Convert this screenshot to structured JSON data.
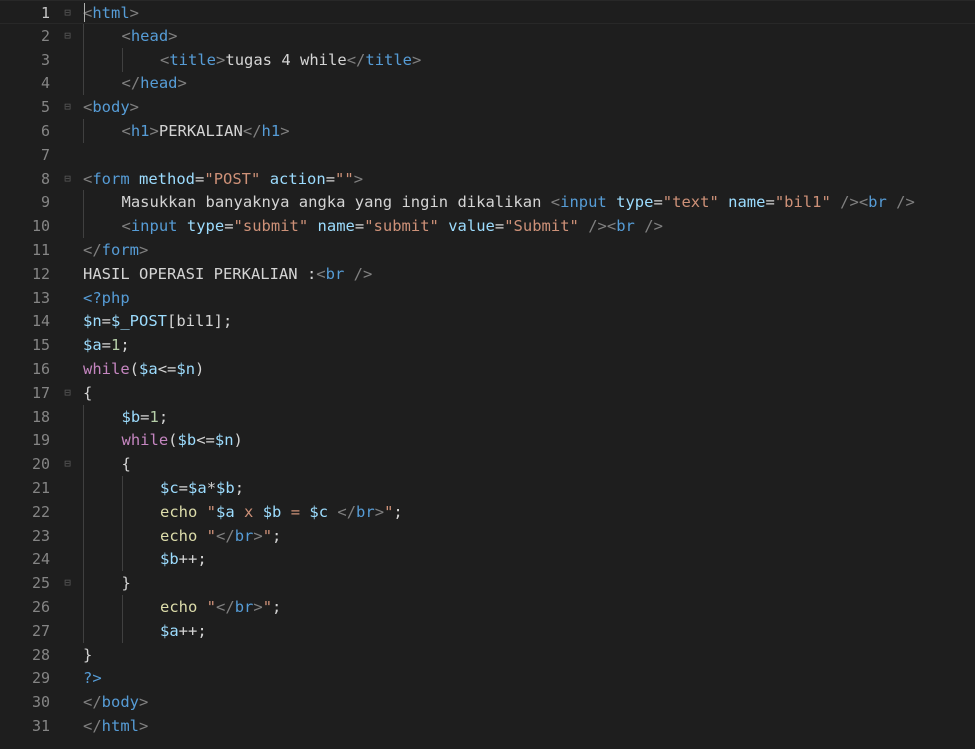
{
  "editor": {
    "language": "php",
    "active_line": 1,
    "lines": [
      {
        "n": "1",
        "indent": 0,
        "fold": true,
        "tokens": [
          [
            "punct",
            "<"
          ],
          [
            "tag",
            "html"
          ],
          [
            "punct",
            ">"
          ]
        ]
      },
      {
        "n": "2",
        "indent": 1,
        "fold": true,
        "tokens": [
          [
            "punct",
            "<"
          ],
          [
            "tag",
            "head"
          ],
          [
            "punct",
            ">"
          ]
        ]
      },
      {
        "n": "3",
        "indent": 2,
        "fold": false,
        "tokens": [
          [
            "punct",
            "<"
          ],
          [
            "tag",
            "title"
          ],
          [
            "punct",
            ">"
          ],
          [
            "txt",
            "tugas 4 while"
          ],
          [
            "punct",
            "</"
          ],
          [
            "tag",
            "title"
          ],
          [
            "punct",
            ">"
          ]
        ]
      },
      {
        "n": "4",
        "indent": 1,
        "fold": false,
        "tokens": [
          [
            "punct",
            "</"
          ],
          [
            "tag",
            "head"
          ],
          [
            "punct",
            ">"
          ]
        ]
      },
      {
        "n": "5",
        "indent": 0,
        "fold": true,
        "tokens": [
          [
            "punct",
            "<"
          ],
          [
            "tag",
            "body"
          ],
          [
            "punct",
            ">"
          ]
        ]
      },
      {
        "n": "6",
        "indent": 1,
        "fold": false,
        "tokens": [
          [
            "punct",
            "<"
          ],
          [
            "tag",
            "h1"
          ],
          [
            "punct",
            ">"
          ],
          [
            "txt",
            "PERKALIAN"
          ],
          [
            "punct",
            "</"
          ],
          [
            "tag",
            "h1"
          ],
          [
            "punct",
            ">"
          ]
        ]
      },
      {
        "n": "7",
        "indent": 0,
        "fold": false,
        "tokens": []
      },
      {
        "n": "8",
        "indent": 0,
        "fold": true,
        "tokens": [
          [
            "punct",
            "<"
          ],
          [
            "tag",
            "form"
          ],
          [
            "txt",
            " "
          ],
          [
            "attr",
            "method"
          ],
          [
            "txt",
            "="
          ],
          [
            "str",
            "\"POST\""
          ],
          [
            "txt",
            " "
          ],
          [
            "attr",
            "action"
          ],
          [
            "txt",
            "="
          ],
          [
            "str",
            "\"\""
          ],
          [
            "punct",
            ">"
          ]
        ]
      },
      {
        "n": "9",
        "indent": 1,
        "fold": false,
        "tokens": [
          [
            "txt",
            "Masukkan banyaknya angka yang ingin dikalikan "
          ],
          [
            "punct",
            "<"
          ],
          [
            "tag",
            "input"
          ],
          [
            "txt",
            " "
          ],
          [
            "attr",
            "type"
          ],
          [
            "txt",
            "="
          ],
          [
            "str",
            "\"text\""
          ],
          [
            "txt",
            " "
          ],
          [
            "attr",
            "name"
          ],
          [
            "txt",
            "="
          ],
          [
            "str",
            "\"bil1\""
          ],
          [
            "txt",
            " "
          ],
          [
            "punct",
            "/><"
          ],
          [
            "tag",
            "br"
          ],
          [
            "txt",
            " "
          ],
          [
            "punct",
            "/>"
          ]
        ]
      },
      {
        "n": "10",
        "indent": 1,
        "fold": false,
        "tokens": [
          [
            "punct",
            "<"
          ],
          [
            "tag",
            "input"
          ],
          [
            "txt",
            " "
          ],
          [
            "attr",
            "type"
          ],
          [
            "txt",
            "="
          ],
          [
            "str",
            "\"submit\""
          ],
          [
            "txt",
            " "
          ],
          [
            "attr",
            "name"
          ],
          [
            "txt",
            "="
          ],
          [
            "str",
            "\"submit\""
          ],
          [
            "txt",
            " "
          ],
          [
            "attr",
            "value"
          ],
          [
            "txt",
            "="
          ],
          [
            "str",
            "\"Submit\""
          ],
          [
            "txt",
            " "
          ],
          [
            "punct",
            "/><"
          ],
          [
            "tag",
            "br"
          ],
          [
            "txt",
            " "
          ],
          [
            "punct",
            "/>"
          ]
        ]
      },
      {
        "n": "11",
        "indent": 0,
        "fold": false,
        "tokens": [
          [
            "punct",
            "</"
          ],
          [
            "tag",
            "form"
          ],
          [
            "punct",
            ">"
          ]
        ]
      },
      {
        "n": "12",
        "indent": 0,
        "fold": false,
        "tokens": [
          [
            "txt",
            "HASIL OPERASI PERKALIAN :"
          ],
          [
            "punct",
            "<"
          ],
          [
            "tag",
            "br"
          ],
          [
            "txt",
            " "
          ],
          [
            "punct",
            "/>"
          ]
        ]
      },
      {
        "n": "13",
        "indent": 0,
        "fold": false,
        "tokens": [
          [
            "tag",
            "<?php"
          ]
        ]
      },
      {
        "n": "14",
        "indent": 0,
        "fold": false,
        "tokens": [
          [
            "var",
            "$n"
          ],
          [
            "txt",
            "="
          ],
          [
            "var",
            "$_POST"
          ],
          [
            "txt",
            "[bil1];"
          ]
        ]
      },
      {
        "n": "15",
        "indent": 0,
        "fold": false,
        "tokens": [
          [
            "var",
            "$a"
          ],
          [
            "txt",
            "="
          ],
          [
            "num",
            "1"
          ],
          [
            "txt",
            ";"
          ]
        ]
      },
      {
        "n": "16",
        "indent": 0,
        "fold": false,
        "tokens": [
          [
            "kw",
            "while"
          ],
          [
            "txt",
            "("
          ],
          [
            "var",
            "$a"
          ],
          [
            "txt",
            "<="
          ],
          [
            "var",
            "$n"
          ],
          [
            "txt",
            ")"
          ]
        ]
      },
      {
        "n": "17",
        "indent": 0,
        "fold": true,
        "tokens": [
          [
            "txt",
            "{"
          ]
        ]
      },
      {
        "n": "18",
        "indent": 1,
        "fold": false,
        "tokens": [
          [
            "var",
            "$b"
          ],
          [
            "txt",
            "="
          ],
          [
            "num",
            "1"
          ],
          [
            "txt",
            ";"
          ]
        ]
      },
      {
        "n": "19",
        "indent": 1,
        "fold": false,
        "tokens": [
          [
            "kw",
            "while"
          ],
          [
            "txt",
            "("
          ],
          [
            "var",
            "$b"
          ],
          [
            "txt",
            "<="
          ],
          [
            "var",
            "$n"
          ],
          [
            "txt",
            ")"
          ]
        ]
      },
      {
        "n": "20",
        "indent": 1,
        "fold": true,
        "tokens": [
          [
            "txt",
            "{"
          ]
        ]
      },
      {
        "n": "21",
        "indent": 2,
        "fold": false,
        "tokens": [
          [
            "var",
            "$c"
          ],
          [
            "txt",
            "="
          ],
          [
            "var",
            "$a"
          ],
          [
            "txt",
            "*"
          ],
          [
            "var",
            "$b"
          ],
          [
            "txt",
            ";"
          ]
        ]
      },
      {
        "n": "22",
        "indent": 2,
        "fold": false,
        "tokens": [
          [
            "fn",
            "echo"
          ],
          [
            "txt",
            " "
          ],
          [
            "str",
            "\""
          ],
          [
            "var",
            "$a"
          ],
          [
            "str",
            " x "
          ],
          [
            "var",
            "$b"
          ],
          [
            "str",
            " = "
          ],
          [
            "var",
            "$c"
          ],
          [
            "str",
            " "
          ],
          [
            "punct",
            "</"
          ],
          [
            "tag",
            "br"
          ],
          [
            "punct",
            ">"
          ],
          [
            "str",
            "\""
          ],
          [
            "txt",
            ";"
          ]
        ]
      },
      {
        "n": "23",
        "indent": 2,
        "fold": false,
        "tokens": [
          [
            "fn",
            "echo"
          ],
          [
            "txt",
            " "
          ],
          [
            "str",
            "\""
          ],
          [
            "punct",
            "</"
          ],
          [
            "tag",
            "br"
          ],
          [
            "punct",
            ">"
          ],
          [
            "str",
            "\""
          ],
          [
            "txt",
            ";"
          ]
        ]
      },
      {
        "n": "24",
        "indent": 2,
        "fold": false,
        "tokens": [
          [
            "var",
            "$b"
          ],
          [
            "txt",
            "++;"
          ]
        ]
      },
      {
        "n": "25",
        "indent": 1,
        "fold": true,
        "tokens": [
          [
            "txt",
            "}"
          ]
        ]
      },
      {
        "n": "26",
        "indent": 2,
        "fold": false,
        "tokens": [
          [
            "fn",
            "echo"
          ],
          [
            "txt",
            " "
          ],
          [
            "str",
            "\""
          ],
          [
            "punct",
            "</"
          ],
          [
            "tag",
            "br"
          ],
          [
            "punct",
            ">"
          ],
          [
            "str",
            "\""
          ],
          [
            "txt",
            ";"
          ]
        ]
      },
      {
        "n": "27",
        "indent": 2,
        "fold": false,
        "tokens": [
          [
            "var",
            "$a"
          ],
          [
            "txt",
            "++;"
          ]
        ]
      },
      {
        "n": "28",
        "indent": 0,
        "fold": false,
        "tokens": [
          [
            "txt",
            "}"
          ]
        ]
      },
      {
        "n": "29",
        "indent": 0,
        "fold": false,
        "tokens": [
          [
            "tag",
            "?>"
          ]
        ]
      },
      {
        "n": "30",
        "indent": 0,
        "fold": false,
        "tokens": [
          [
            "punct",
            "</"
          ],
          [
            "tag",
            "body"
          ],
          [
            "punct",
            ">"
          ]
        ]
      },
      {
        "n": "31",
        "indent": 0,
        "fold": false,
        "tokens": [
          [
            "punct",
            "</"
          ],
          [
            "tag",
            "html"
          ],
          [
            "punct",
            ">"
          ]
        ]
      }
    ]
  },
  "colors": {
    "background": "#1e1e1e",
    "tag": "#569cd6",
    "attribute": "#9cdcfe",
    "string": "#ce9178",
    "keyword": "#c586c0",
    "number": "#b5cea8",
    "function": "#dcdcaa",
    "line_number": "#858585"
  }
}
